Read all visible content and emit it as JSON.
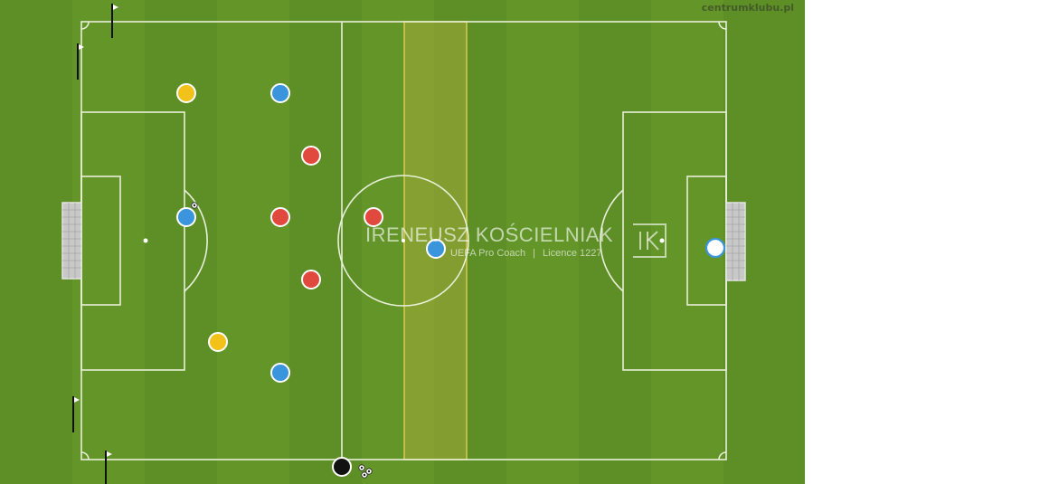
{
  "watermark": {
    "site": "centrumklubu.pl"
  },
  "coach": {
    "name": "IRENEUSZ KOŚCIELNIAK",
    "title": "UEFA Pro Coach",
    "licence": "Licence 1227",
    "logo_letters": "IK"
  },
  "colors": {
    "grass_light": "#6b9b30",
    "grass_dark": "#5d8c27",
    "line": "#e8efd8",
    "zone_fill": "#c9b845",
    "player_yellow": "#f2c21b",
    "player_blue": "#3a95dc",
    "player_red": "#e2493e",
    "player_black": "#111111",
    "player_white": "#ffffff"
  },
  "players": [
    {
      "team": "yellow",
      "role": "player"
    },
    {
      "team": "yellow",
      "role": "player"
    },
    {
      "team": "blue",
      "role": "player"
    },
    {
      "team": "blue",
      "role": "player"
    },
    {
      "team": "blue",
      "role": "player"
    },
    {
      "team": "blue",
      "role": "player"
    },
    {
      "team": "red",
      "role": "player"
    },
    {
      "team": "red",
      "role": "player"
    },
    {
      "team": "red",
      "role": "player"
    },
    {
      "team": "red",
      "role": "player"
    },
    {
      "team": "white",
      "role": "goalkeeper"
    },
    {
      "team": "black",
      "role": "coach"
    }
  ],
  "objects": {
    "flags": 4,
    "balls": 3,
    "goals": 2,
    "highlight_zone": "yellow-vertical-strip"
  }
}
